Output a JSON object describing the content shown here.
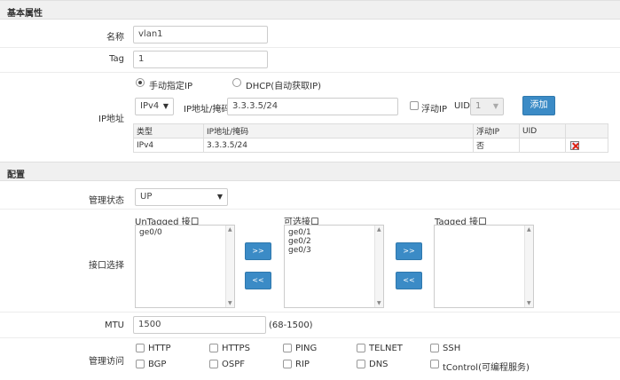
{
  "basic": {
    "header": "基本属性",
    "name_label": "名称",
    "name_value": "vlan1",
    "tag_label": "Tag",
    "tag_value": "1",
    "ip_label": "IP地址",
    "radio_manual": "手动指定IP",
    "radio_dhcp": "DHCP(自动获取IP)",
    "ip_version": "IPv4",
    "ip_mask_label": "IP地址/掩码",
    "ip_mask_value": "3.3.3.5/24",
    "floating_ip_label": "浮动IP",
    "uid_label": "UID",
    "uid_value": "1",
    "add_button": "添加",
    "table": {
      "headers": [
        "类型",
        "IP地址/掩码",
        "浮动IP",
        "UID",
        ""
      ],
      "rows": [
        {
          "type": "IPv4",
          "ip": "3.3.3.5/24",
          "floating": "否",
          "uid": ""
        }
      ]
    }
  },
  "config": {
    "header": "配置",
    "admin_state_label": "管理状态",
    "admin_state_value": "UP",
    "iface_label": "接口选择",
    "untagged_title": "UnTagged 接口",
    "untagged_items": [
      "ge0/0"
    ],
    "available_title": "可选接口",
    "available_items": [
      "ge0/1",
      "ge0/2",
      "ge0/3"
    ],
    "tagged_title": "Tagged 接口",
    "tagged_items": [],
    "move_right": ">>",
    "move_left": "<<",
    "mtu_label": "MTU",
    "mtu_value": "1500",
    "mtu_range": "(68-1500)",
    "mgmt_label": "管理访问",
    "mgmt_options": [
      "HTTP",
      "HTTPS",
      "PING",
      "TELNET",
      "SSH",
      "BGP",
      "OSPF",
      "RIP",
      "DNS",
      "tControl(可编程服务)"
    ]
  }
}
